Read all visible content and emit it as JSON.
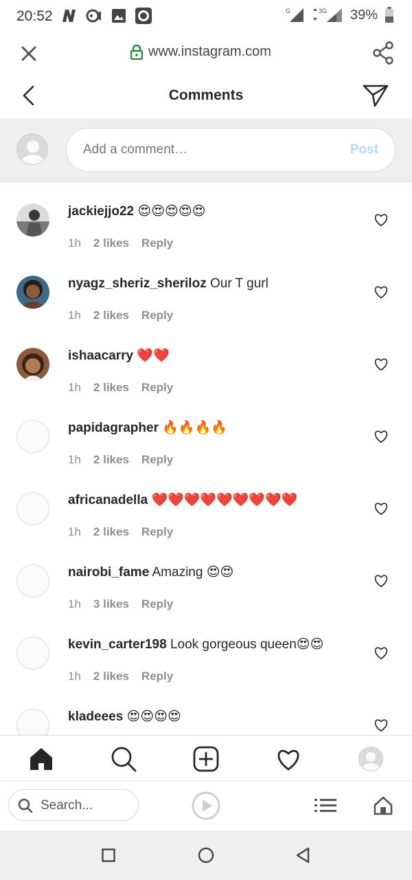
{
  "status": {
    "time": "20:52",
    "network_g": "G",
    "network_3g": "3G",
    "battery": "39%"
  },
  "browser": {
    "url": "www.instagram.com"
  },
  "header": {
    "title": "Comments"
  },
  "composer": {
    "placeholder": "Add a comment…",
    "post_label": "Post"
  },
  "comments": [
    {
      "user": "jackiejjo22",
      "text": "😍😍😍😍😍",
      "time": "1h",
      "likes": "2 likes",
      "reply": "Reply"
    },
    {
      "user": "nyagz_sheriz_sheriloz",
      "text": "Our T gurl",
      "time": "1h",
      "likes": "2 likes",
      "reply": "Reply"
    },
    {
      "user": "ishaacarry",
      "text": "❤️❤️",
      "time": "1h",
      "likes": "2 likes",
      "reply": "Reply"
    },
    {
      "user": "papidagrapher",
      "text": "🔥🔥🔥🔥",
      "time": "1h",
      "likes": "2 likes",
      "reply": "Reply"
    },
    {
      "user": "africanadella",
      "text": "❤️❤️❤️❤️❤️❤️❤️❤️❤️",
      "time": "1h",
      "likes": "2 likes",
      "reply": "Reply"
    },
    {
      "user": "nairobi_fame",
      "text": "Amazing 😍😍",
      "time": "1h",
      "likes": "3 likes",
      "reply": "Reply"
    },
    {
      "user": "kevin_carter198",
      "text": "Look gorgeous queen😍😍",
      "time": "1h",
      "likes": "2 likes",
      "reply": "Reply"
    },
    {
      "user": "kladeees",
      "text": "😍😍😍😍",
      "time": "",
      "likes": "",
      "reply": ""
    }
  ],
  "toolbar": {
    "search_placeholder": "Search..."
  },
  "colors": {
    "accent_post": "#b3dbff",
    "text_primary": "#262626",
    "text_muted": "#8e8e8e"
  }
}
